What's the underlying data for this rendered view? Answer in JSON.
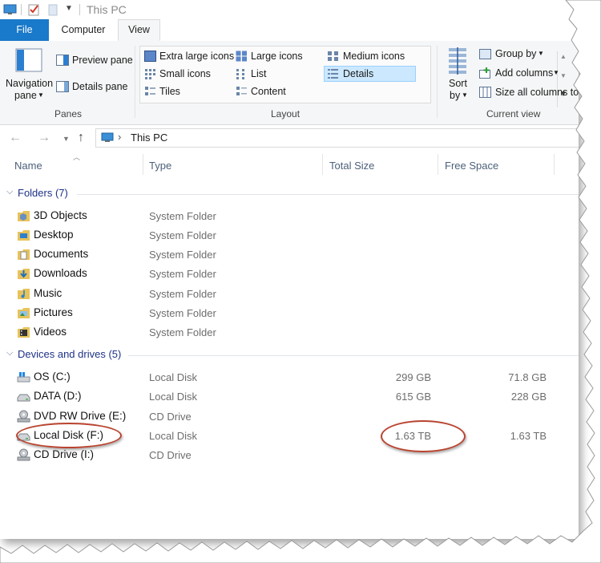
{
  "titlebar": {
    "title": "This PC"
  },
  "tabs": [
    {
      "label": "File"
    },
    {
      "label": "Computer"
    },
    {
      "label": "View"
    }
  ],
  "ribbon": {
    "panes": {
      "navigation_pane": "Navigation",
      "navigation_pane_2": "pane",
      "preview_pane": "Preview pane",
      "details_pane": "Details pane",
      "group_label": "Panes"
    },
    "layout": {
      "items": [
        "Extra large icons",
        "Large icons",
        "Medium icons",
        "Small icons",
        "List",
        "Details",
        "Tiles",
        "Content"
      ],
      "selected": "Details",
      "group_label": "Layout"
    },
    "current_view": {
      "sort_by": "Sort",
      "sort_by_2": "by",
      "group_by": "Group by",
      "add_columns": "Add columns",
      "size_all": "Size all columns to",
      "group_label": "Current view"
    }
  },
  "address": {
    "crumb": "This PC"
  },
  "columns": [
    "Name",
    "Type",
    "Total Size",
    "Free Space"
  ],
  "groups": [
    {
      "title": "Folders (7)",
      "items": [
        {
          "name": "3D Objects",
          "type": "System Folder"
        },
        {
          "name": "Desktop",
          "type": "System Folder"
        },
        {
          "name": "Documents",
          "type": "System Folder"
        },
        {
          "name": "Downloads",
          "type": "System Folder"
        },
        {
          "name": "Music",
          "type": "System Folder"
        },
        {
          "name": "Pictures",
          "type": "System Folder"
        },
        {
          "name": "Videos",
          "type": "System Folder"
        }
      ]
    },
    {
      "title": "Devices and drives (5)",
      "items": [
        {
          "name": "OS (C:)",
          "type": "Local Disk",
          "total": "299 GB",
          "free": "71.8 GB"
        },
        {
          "name": "DATA (D:)",
          "type": "Local Disk",
          "total": "615 GB",
          "free": "228 GB"
        },
        {
          "name": "DVD RW Drive (E:)",
          "type": "CD Drive",
          "total": "",
          "free": ""
        },
        {
          "name": "Local Disk (F:)",
          "type": "Local Disk",
          "total": "1.63 TB",
          "free": "1.63 TB"
        },
        {
          "name": "CD Drive (I:)",
          "type": "CD Drive",
          "total": "",
          "free": ""
        }
      ]
    }
  ],
  "colors": {
    "accent": "#1979ca",
    "annotation": "#b9442f",
    "group_title": "#1e3287"
  }
}
